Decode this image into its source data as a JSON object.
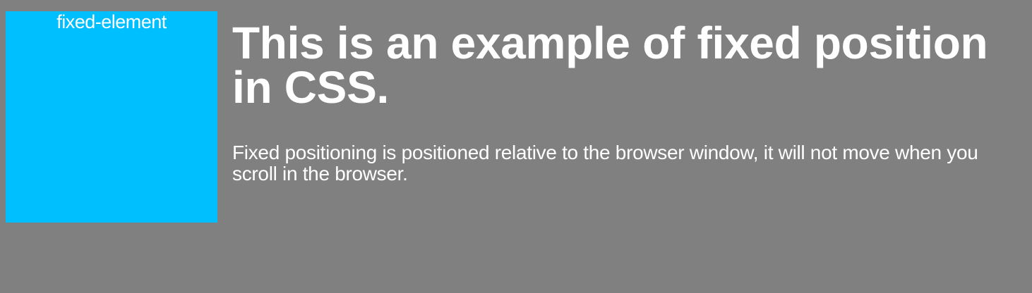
{
  "fixed_box": {
    "label": "fixed-element",
    "color": "#00bfff"
  },
  "main": {
    "heading": "This is an example of fixed position in CSS.",
    "paragraph": "Fixed positioning is positioned relative to the browser window, it will not move when you scroll in the browser."
  },
  "colors": {
    "background": "#808080",
    "text": "#ffffff"
  }
}
